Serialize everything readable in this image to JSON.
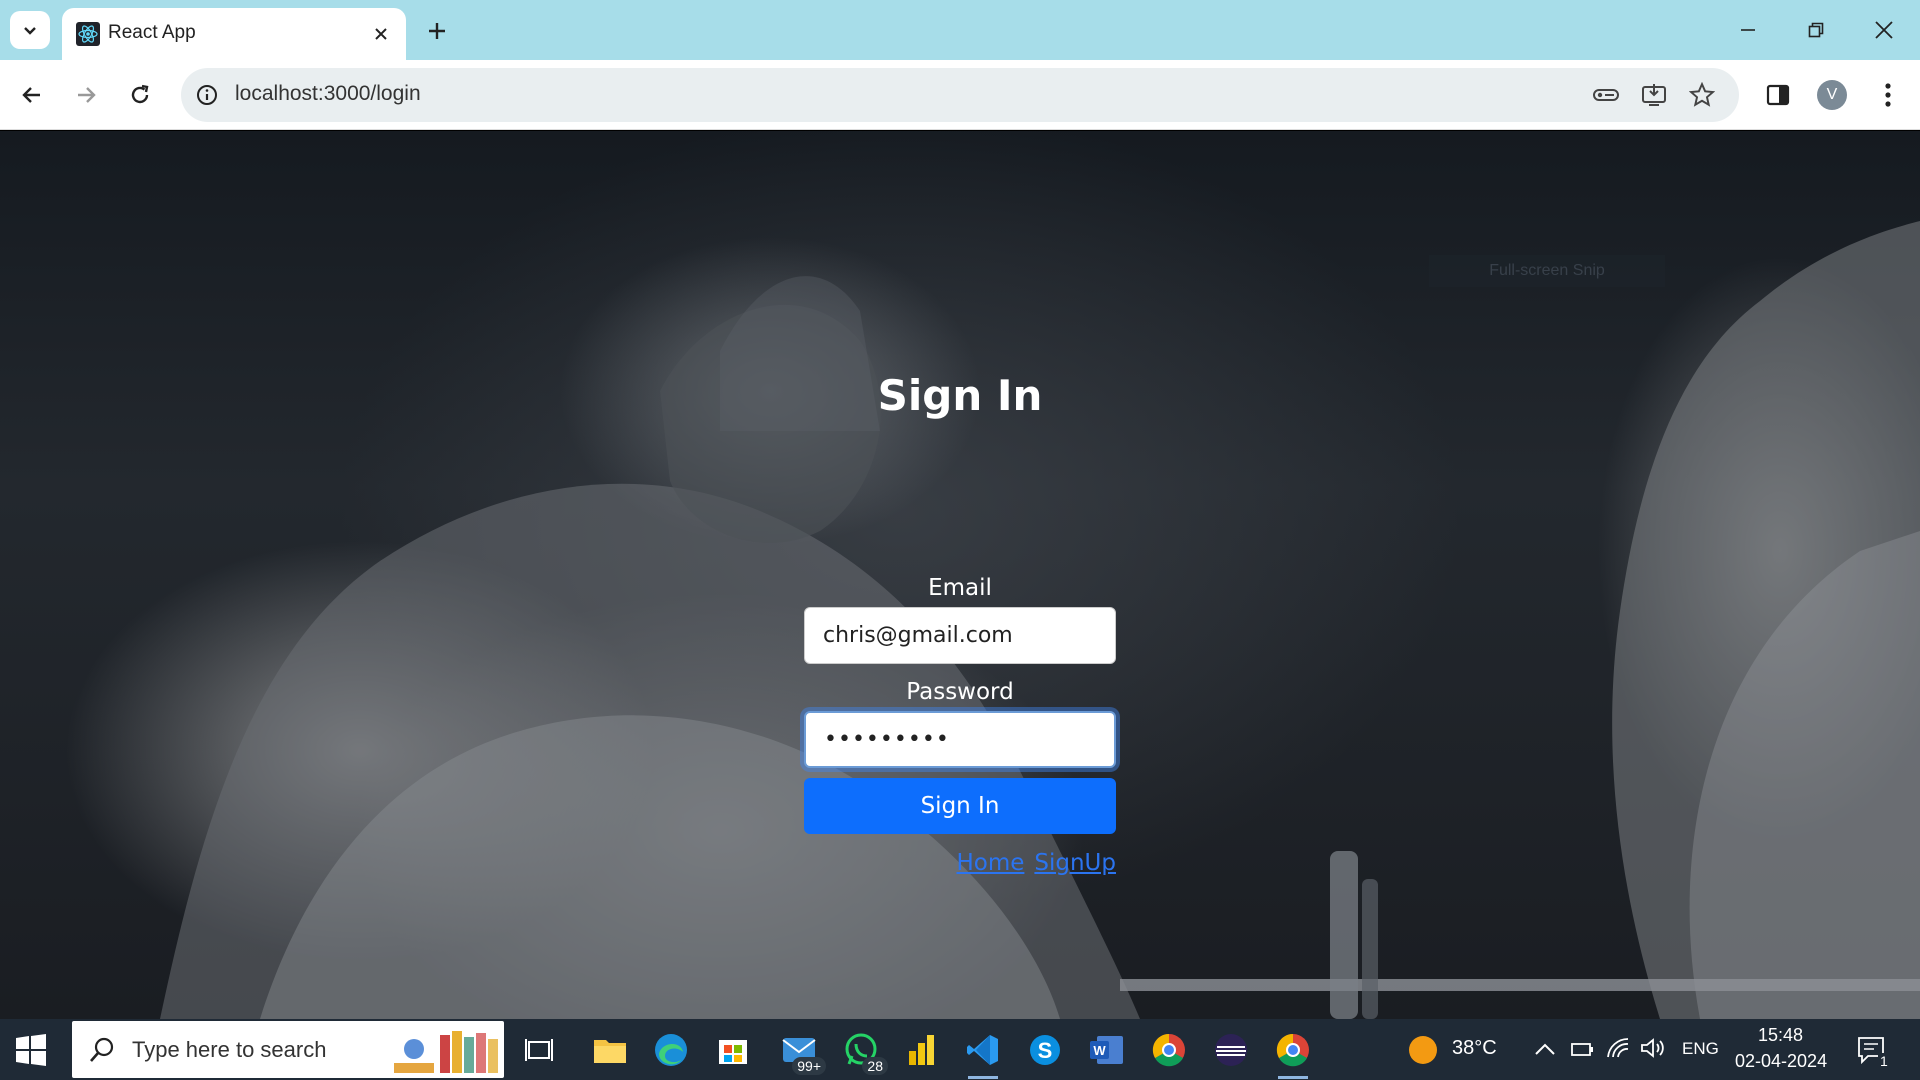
{
  "browser": {
    "tab_title": "React App",
    "url": "localhost:3000/login",
    "profile_initial": "V"
  },
  "page": {
    "snip_hint": "Full-screen Snip",
    "title": "Sign In",
    "email_label": "Email",
    "email_value": "chris@gmail.com",
    "password_label": "Password",
    "password_value": "•••••••••",
    "submit_label": "Sign In",
    "links": {
      "home": "Home",
      "signup": "SignUp"
    }
  },
  "taskbar": {
    "search_placeholder": "Type here to search",
    "mail_badge": "99+",
    "whatsapp_badge": "28",
    "weather": "38°C",
    "language": "ENG",
    "time": "15:48",
    "date": "02-04-2024",
    "notification_count": "1"
  },
  "colors": {
    "tabbar_bg": "#a7dde9",
    "primary_button": "#0d6efd",
    "link": "#2b74f0",
    "taskbar_bg": "#1f2a36"
  }
}
